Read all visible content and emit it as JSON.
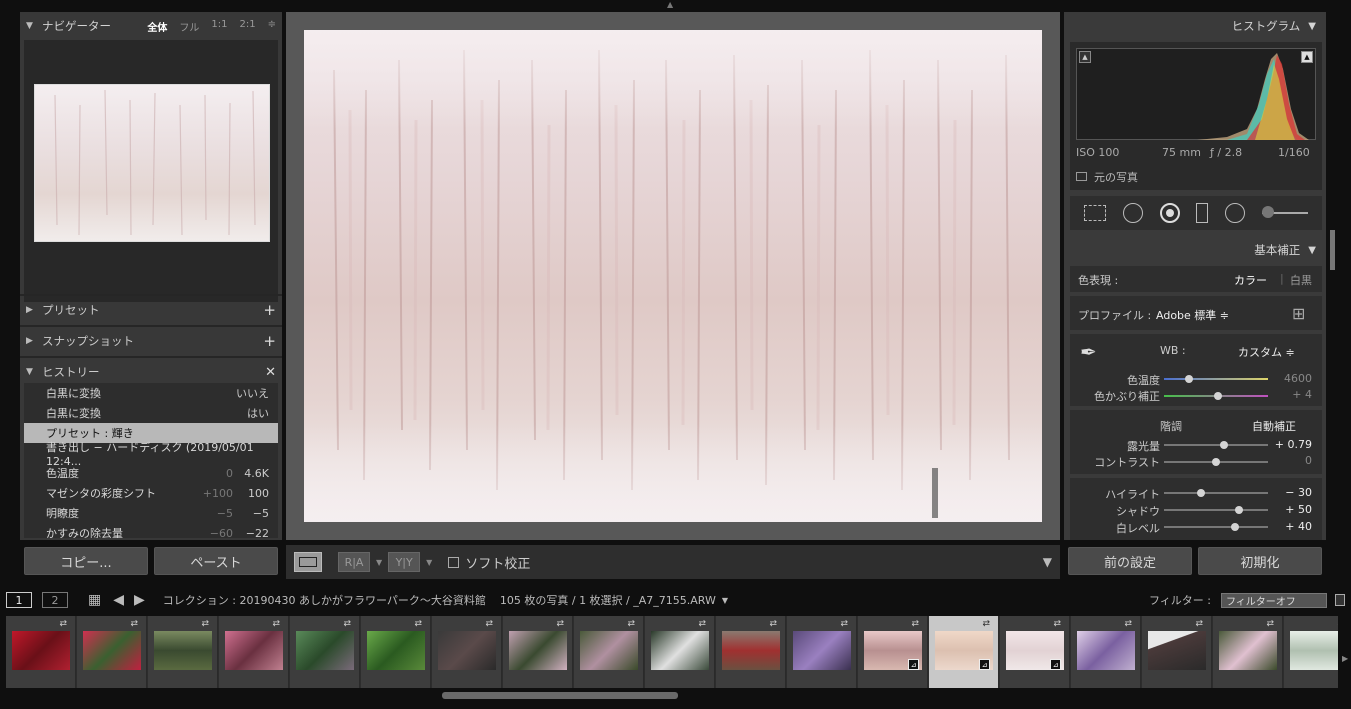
{
  "navigator": {
    "title": "ナビゲーター",
    "zoom": [
      "全体",
      "フル",
      "1:1",
      "2:1"
    ],
    "selected_zoom": "全体"
  },
  "sections": {
    "presets": "プリセット",
    "snapshots": "スナップショット",
    "history": "ヒストリー"
  },
  "history_items": [
    {
      "label": "白黒に変換",
      "v1": "",
      "v2": "いいえ"
    },
    {
      "label": "白黒に変換",
      "v1": "",
      "v2": "はい"
    },
    {
      "label": "プリセット : 輝き",
      "v1": "",
      "v2": ""
    },
    {
      "label": "書き出し − ハードディスク (2019/05/01 12:4...",
      "v1": "",
      "v2": ""
    },
    {
      "label": "色温度",
      "v1": "0",
      "v2": "4.6K"
    },
    {
      "label": "マゼンタの彩度シフト",
      "v1": "+100",
      "v2": "100"
    },
    {
      "label": "明瞭度",
      "v1": "−5",
      "v2": "−5"
    },
    {
      "label": "かすみの除去量",
      "v1": "−60",
      "v2": "−22"
    }
  ],
  "left_buttons": {
    "copy": "コピー...",
    "paste": "ペースト"
  },
  "toolbar": {
    "view_ra": "R|A",
    "view_yy": "Y|Y",
    "soft_proof": "ソフト校正"
  },
  "histogram": {
    "title": "ヒストグラム",
    "iso": "ISO 100",
    "focal": "75 mm",
    "aperture": "ƒ / 2.8",
    "shutter": "1/160",
    "original_photo": "元の写真"
  },
  "basic": {
    "title": "基本補正",
    "treatment_label": "色表現 :",
    "color": "カラー",
    "bw": "白黒",
    "profile_label": "プロファイル :",
    "profile_value": "Adobe 標準 ≑",
    "wb_label": "WB :",
    "wb_value": "カスタム ≑",
    "temp_label": "色温度",
    "temp_value": "4600",
    "tint_label": "色かぶり補正",
    "tint_value": "+ 4",
    "tone_label": "階調",
    "auto_label": "自動補正",
    "exposure_label": "露光量",
    "exposure_value": "+ 0.79",
    "contrast_label": "コントラスト",
    "contrast_value": "0",
    "highlights_label": "ハイライト",
    "highlights_value": "− 30",
    "shadows_label": "シャドウ",
    "shadows_value": "+ 50",
    "whites_label": "白レベル",
    "whites_value": "+ 40"
  },
  "sliders": {
    "temp": 0.24,
    "tint": 0.52,
    "exposure": 0.58,
    "contrast": 0.5,
    "highlights": 0.36,
    "shadows": 0.72,
    "whites": 0.68
  },
  "right_buttons": {
    "previous": "前の設定",
    "reset": "初期化"
  },
  "filmbar": {
    "screen1": "1",
    "screen2": "2",
    "collection": "コレクション : 20190430  あしかがフラワーパーク〜大谷資料館",
    "count": "105 枚の写真 / 1 枚選択 / _A7_7155.ARW",
    "filter_label": "フィルター :",
    "filter_value": "フィルターオフ"
  },
  "colors": {
    "panel": "#3a3a3a",
    "center": "#585858",
    "selected": "#b8b8b8"
  }
}
